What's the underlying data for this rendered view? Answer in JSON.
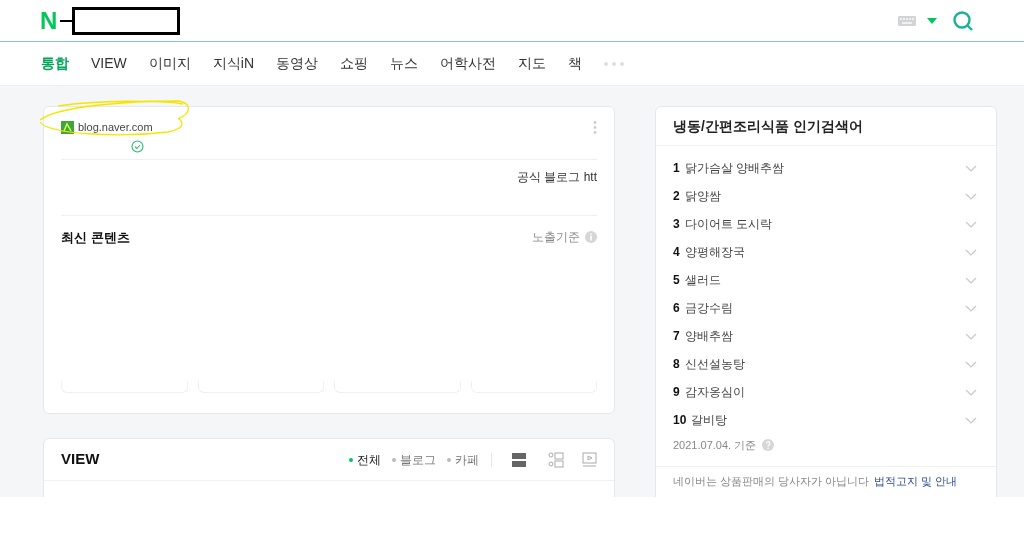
{
  "header": {
    "logo_text": "N"
  },
  "nav_tabs": [
    {
      "label": "통합",
      "selected": true
    },
    {
      "label": "VIEW",
      "selected": false
    },
    {
      "label": "이미지",
      "selected": false
    },
    {
      "label": "지식iN",
      "selected": false
    },
    {
      "label": "동영상",
      "selected": false
    },
    {
      "label": "쇼핑",
      "selected": false
    },
    {
      "label": "뉴스",
      "selected": false
    },
    {
      "label": "어학사전",
      "selected": false
    },
    {
      "label": "지도",
      "selected": false
    },
    {
      "label": "책",
      "selected": false
    }
  ],
  "site_card": {
    "site": "blog.naver.com",
    "verified": true,
    "description": "공식 블로그 htt",
    "section_title": "최신 콘텐츠",
    "criteria": "노출기준"
  },
  "view_card": {
    "title": "VIEW",
    "filters": [
      {
        "label": "전체",
        "selected": true
      },
      {
        "label": "블로그",
        "selected": false
      },
      {
        "label": "카페",
        "selected": false
      }
    ]
  },
  "ranking": {
    "title": "냉동/간편조리식품 인기검색어",
    "items": [
      {
        "rank": "1",
        "term": "닭가슴살 양배추쌈"
      },
      {
        "rank": "2",
        "term": "닭양쌈"
      },
      {
        "rank": "3",
        "term": "다이어트 도시락"
      },
      {
        "rank": "4",
        "term": "양평해장국"
      },
      {
        "rank": "5",
        "term": "샐러드"
      },
      {
        "rank": "6",
        "term": "금강수림"
      },
      {
        "rank": "7",
        "term": "양배추쌈"
      },
      {
        "rank": "8",
        "term": "신선설농탕"
      },
      {
        "rank": "9",
        "term": "감자옹심이"
      },
      {
        "rank": "10",
        "term": "갈비탕"
      }
    ],
    "date": "2021.07.04. 기준",
    "notice": "네이버는 상품판매의 당사자가 아닙니다",
    "notice_link": "법적고지 및 안내"
  }
}
